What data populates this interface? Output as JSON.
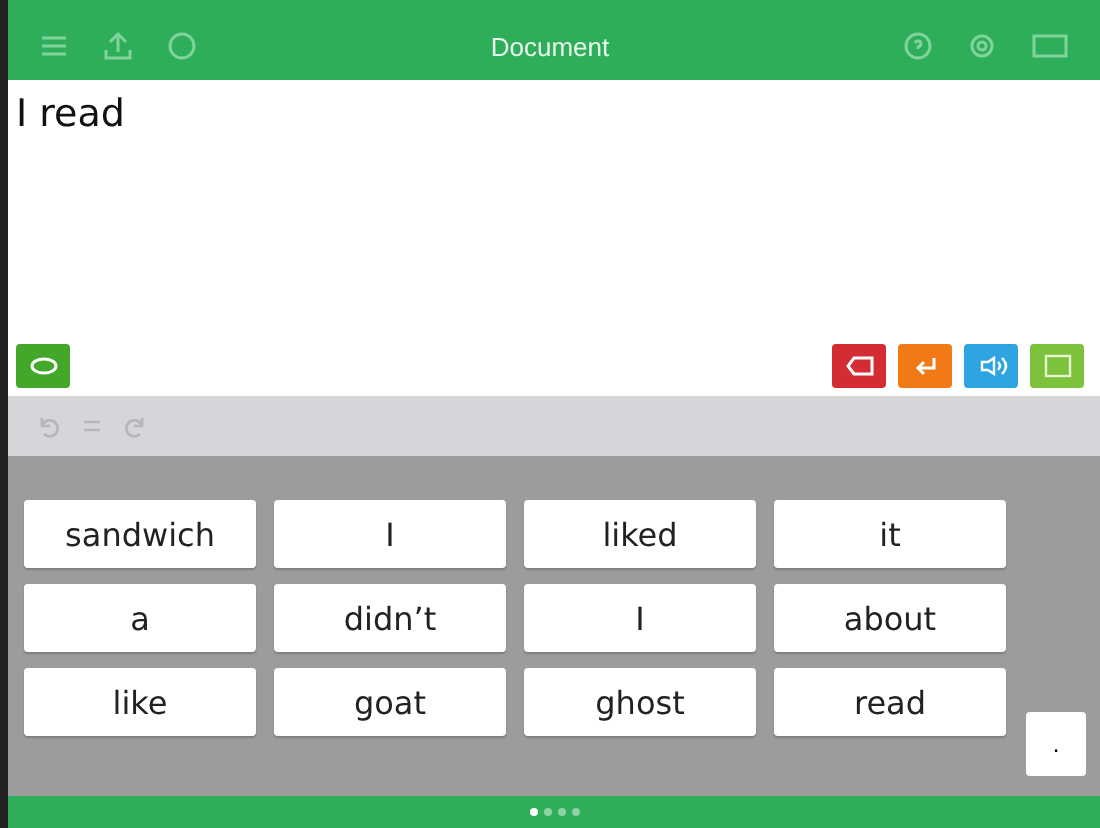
{
  "header": {
    "title": "Document"
  },
  "document": {
    "text": "I read"
  },
  "words": [
    "sandwich",
    "I",
    "liked",
    "it",
    "a",
    "didn’t",
    "I",
    "about",
    "like",
    "goat",
    "ghost",
    "read"
  ],
  "punctuation_key": ".",
  "pages": [
    {
      "selected": true
    },
    {
      "selected": false
    },
    {
      "selected": false
    },
    {
      "selected": false
    }
  ]
}
